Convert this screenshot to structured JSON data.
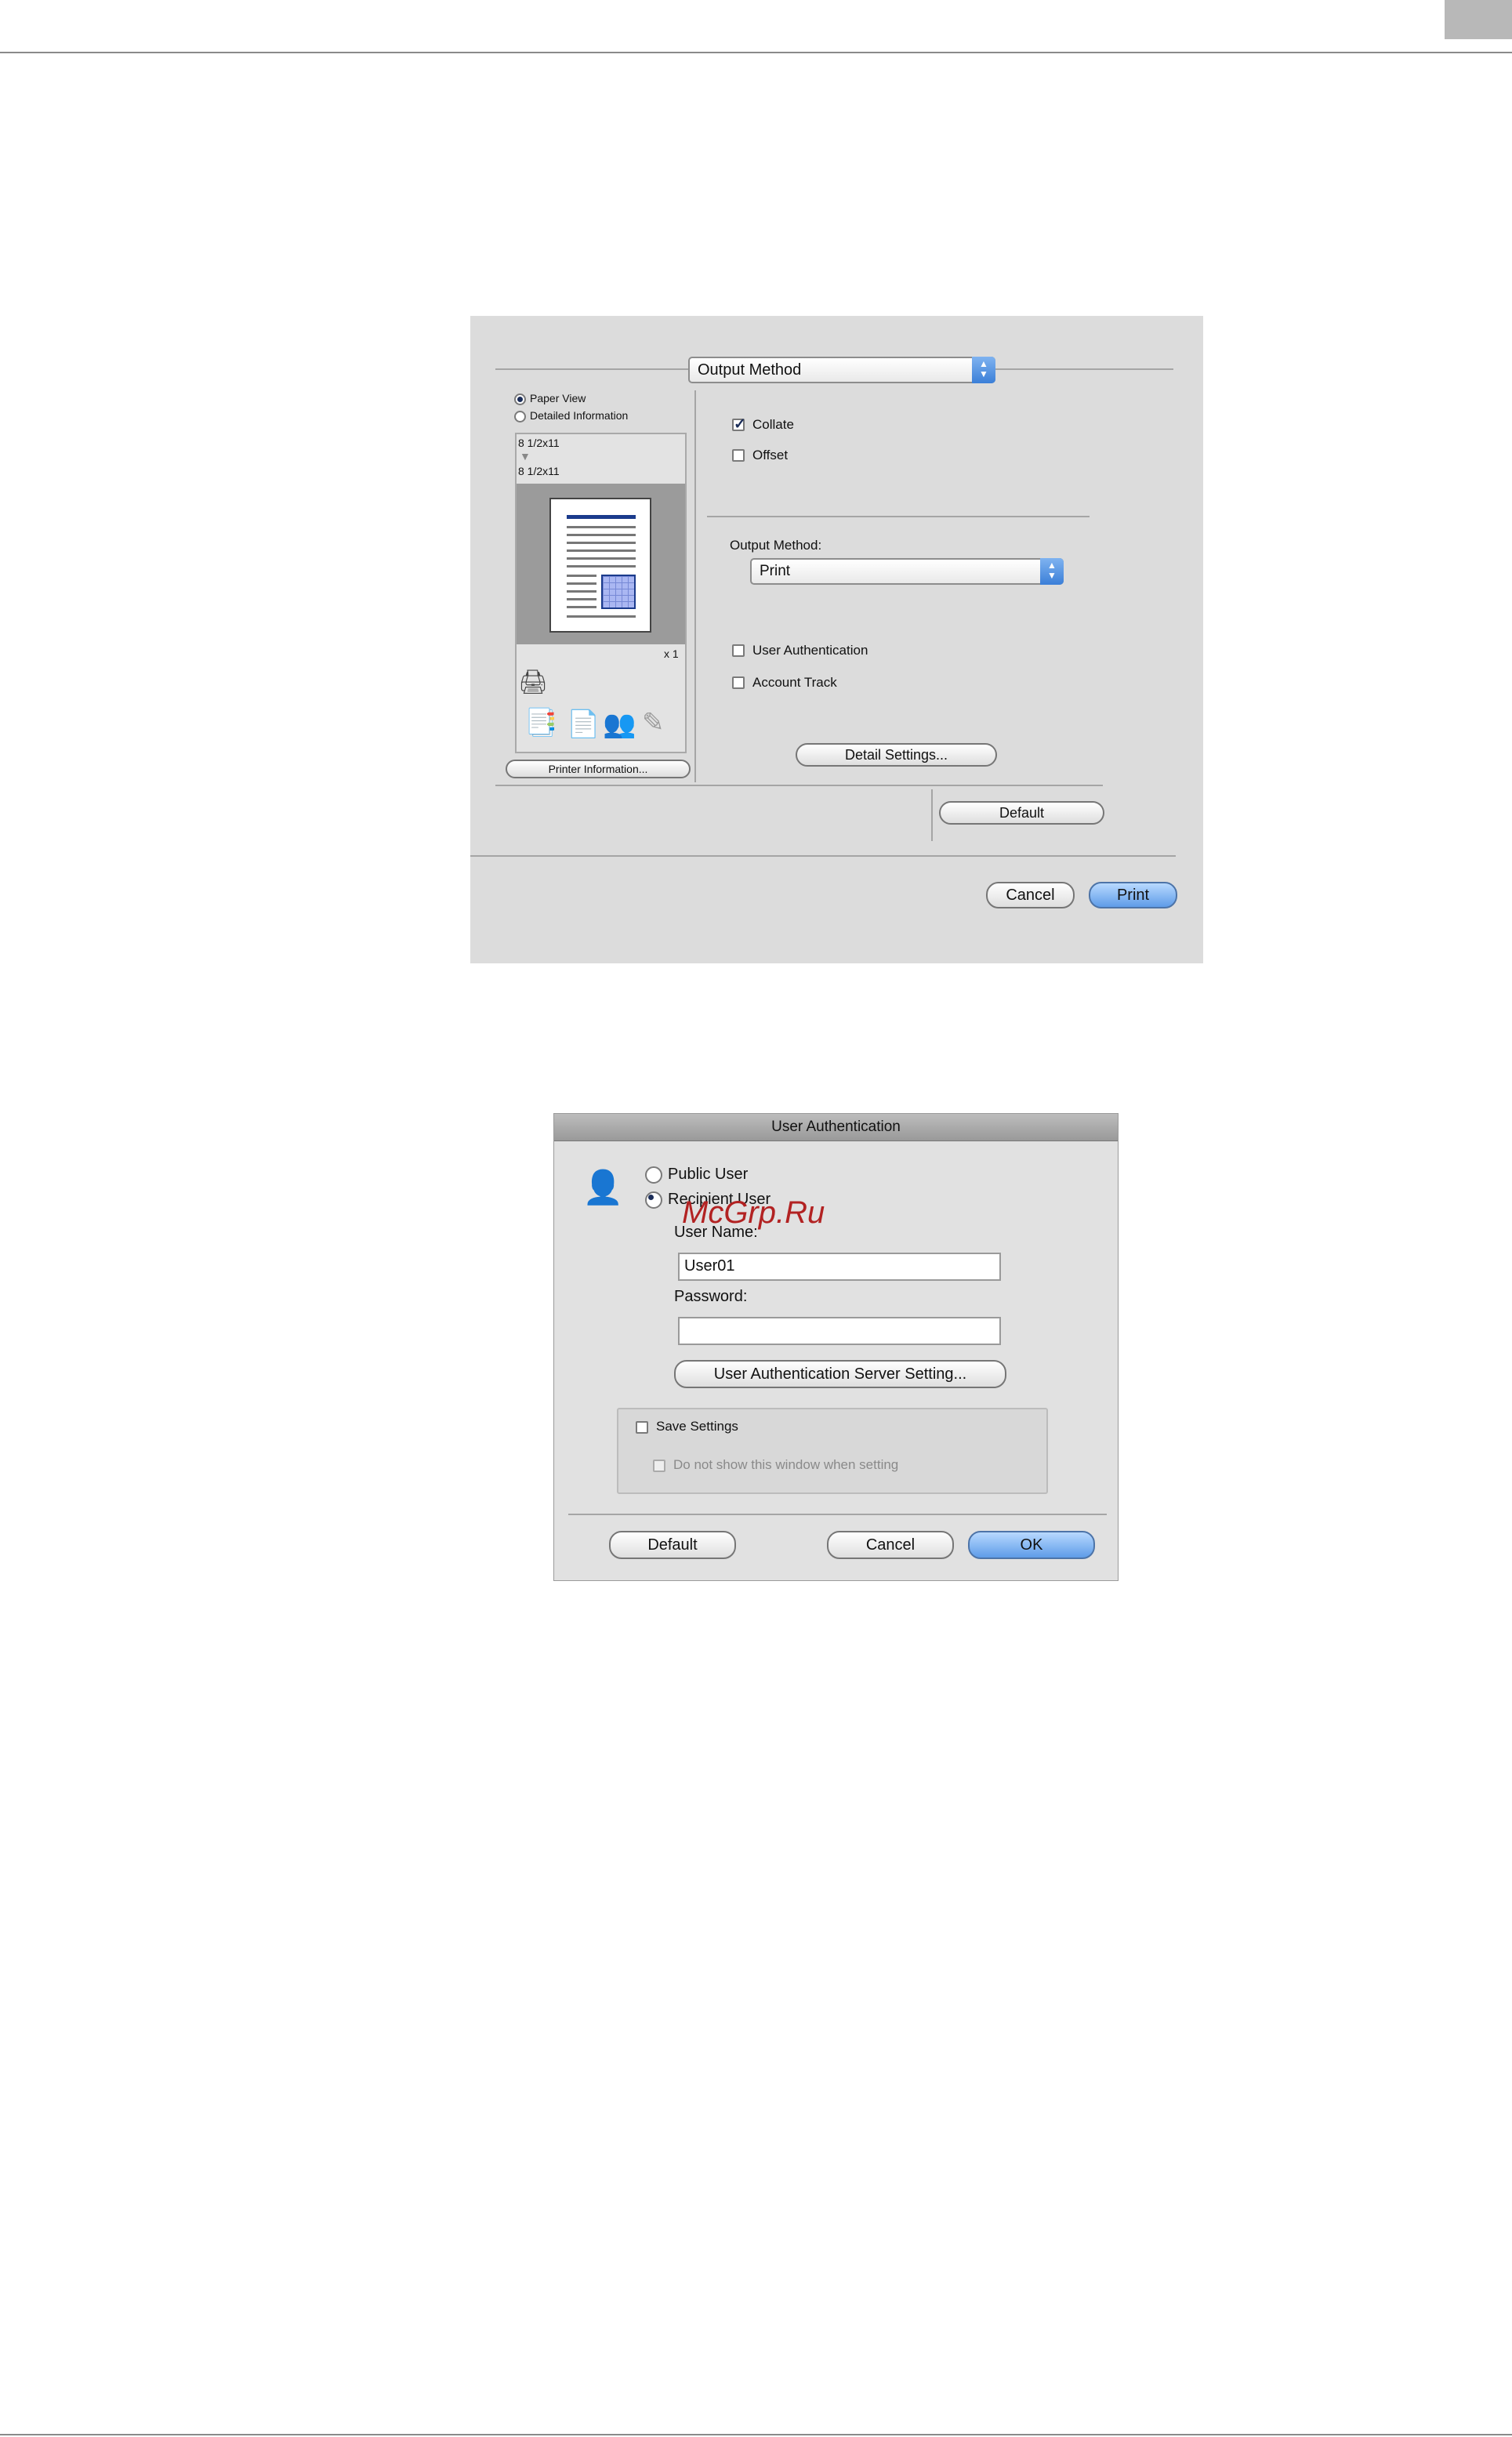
{
  "print_dialog": {
    "panel_popup": "Output Method",
    "view_options": [
      "Paper View",
      "Detailed Information"
    ],
    "paper_source": "8 1/2x11",
    "paper_output": "8 1/2x11",
    "copies": "x 1",
    "printer_info_button": "Printer Information...",
    "collate_label": "Collate",
    "offset_label": "Offset",
    "output_method_label": "Output Method:",
    "output_method_value": "Print",
    "user_auth_label": "User Authentication",
    "account_track_label": "Account Track",
    "detail_settings_button": "Detail Settings...",
    "default_button": "Default",
    "cancel_button": "Cancel",
    "print_button": "Print",
    "icons": [
      "output-tray-icon",
      "booklet-icon",
      "users-icon",
      "pen-icon"
    ]
  },
  "auth_dialog": {
    "title": "User Authentication",
    "public_user_label": "Public User",
    "recipient_user_label": "Recipient User",
    "user_name_label": "User Name:",
    "user_name_value": "User01",
    "password_label": "Password:",
    "password_value": "",
    "server_setting_button": "User Authentication Server Setting...",
    "save_settings_label": "Save Settings",
    "do_not_show_label": "Do not show this window when setting",
    "default_button": "Default",
    "cancel_button": "Cancel",
    "ok_button": "OK"
  },
  "watermark": "McGrp.Ru"
}
